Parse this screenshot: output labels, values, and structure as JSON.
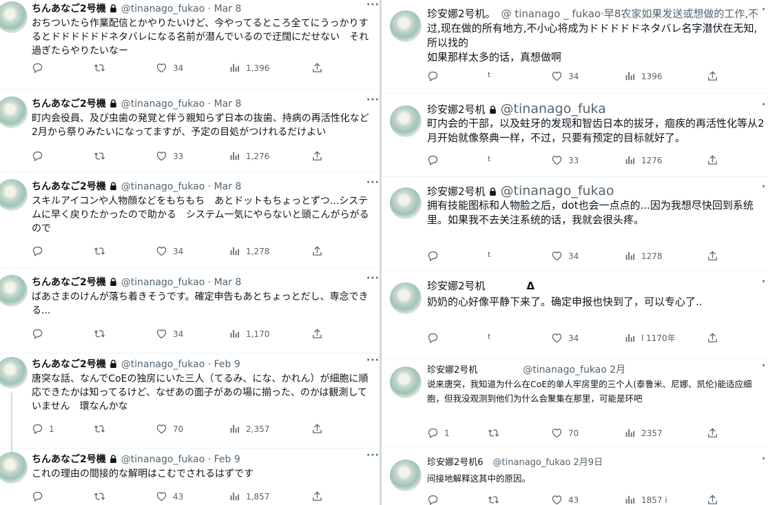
{
  "left": {
    "tweets": [
      {
        "name": "ちんあなご2号機",
        "handle": "@tinanago_fukao · Mar 8",
        "text": "おちついたら作業配信とかやりたいけど、今やってるところ全てにうっかりするとドドドドドドネタバレになる名前が潜んでいるので迂闊にだせない　それ過ぎたらやりたいなー",
        "replies": "",
        "retweets": "",
        "likes": "34",
        "views": "1,396"
      },
      {
        "name": "ちんあなご2号機",
        "handle": "@tinanago_fukao · Mar 8",
        "text": "町内会役員、及び虫歯の発覚と伴う親知らず日本の抜歯、持病の再活性化など2月から祭りみたいになってますが、予定の目処がつけれるだけよい",
        "replies": "",
        "retweets": "",
        "likes": "33",
        "views": "1,276"
      },
      {
        "name": "ちんあなご2号機",
        "handle": "@tinanago_fukao · Mar 8",
        "text": "スキルアイコンや人物顔などをもちもち　あとドットもちょっとずつ...システムに早く戻りたかったので助かる　システム一気にやらないと頭こんがらがるので",
        "replies": "",
        "retweets": "",
        "likes": "34",
        "views": "1,278"
      },
      {
        "name": "ちんあなご2号機",
        "handle": "@tinanago_fukao · Mar 8",
        "text": "ばあさまのけんが落ち着きそうです。確定申告もあとちょっとだし、専念できる...",
        "replies": "",
        "retweets": "",
        "likes": "34",
        "views": "1,170"
      },
      {
        "name": "ちんあなご2号機",
        "handle": "@tinanago_fukao · Feb 9",
        "text": "唐突な話、なんでCoEの独房にいた三人（てるみ、にな、かれん）が細胞に順応できたかは知ってるけど、なぜあの面子があの場に揃った、のかは観測していません　環なんかな",
        "replies": "1",
        "retweets": "",
        "likes": "70",
        "views": "2,357"
      },
      {
        "name": "ちんあなご2号機",
        "handle": "@tinanago_fukao · Feb 9",
        "text": "これの理由の間接的な解明はこむでされるはずです",
        "replies": "",
        "retweets": "",
        "likes": "43",
        "views": "1,857"
      }
    ]
  },
  "right": {
    "tweets": [
      {
        "name": "珍安娜2号机。",
        "handle": "@ tinanago _ fukao·早8农家如果发送或想做的工作,不",
        "text": "过,现在做的所有地方,不小心将成为ドドドドドネタバレ名字潜伏在无知,所以找的\n如果那样太多的话，真想做啊",
        "replies": "",
        "retweets": "t",
        "likes": "34",
        "views": "1396"
      },
      {
        "name": "珍安娜2号机",
        "handle": "@tinanago_fuka",
        "text": "町内会的干部，以及蛀牙的发现和智齿日本的拔牙，痼疾的再活性化等从2月开始就像祭典一样，不过，只要有预定的目标就好了。",
        "replies": "",
        "retweets": "t",
        "likes": "33",
        "views": "1276"
      },
      {
        "name": "珍安娜2号机",
        "handle": "@tinanago_fukao",
        "text": "拥有技能图标和人物脸之后，dot也会一点点的...因为我想尽快回到系统里。如果我不去关注系统的话，我就会很头疼。",
        "replies": "",
        "retweets": "t",
        "likes": "34",
        "views": "1278"
      },
      {
        "name": "珍安娜2号机",
        "handle": "Δ",
        "text": "奶奶的心好像平静下来了。确定申报也快到了，可以专心了..",
        "replies": "",
        "retweets": "t",
        "likes": "34",
        "views": "l 1170年"
      },
      {
        "name": "珍安娜2号机",
        "handle": "@tinanago_fukao 2月",
        "text": "说来唐突，我知道为什么在CoE的单人牢房里的三个人(泰鲁米、尼娜、凯伦)能适应细胞，但我没观测到他们为什么会聚集在那里，可能是环吧",
        "replies": "1",
        "retweets": "",
        "likes": "70",
        "views": "2357"
      },
      {
        "name": "珍安娜2号机6",
        "handle": "@tinanago_fukao 2月9日",
        "text": "间接地解释这其中的原因。",
        "replies": "",
        "retweets": "",
        "likes": "43",
        "views": "1857 i"
      }
    ]
  },
  "icons": {
    "reply": "reply-icon",
    "retweet": "retweet-icon",
    "like": "like-icon",
    "views": "views-icon",
    "share": "share-icon",
    "lock": "lock-icon",
    "more": "more-icon"
  }
}
